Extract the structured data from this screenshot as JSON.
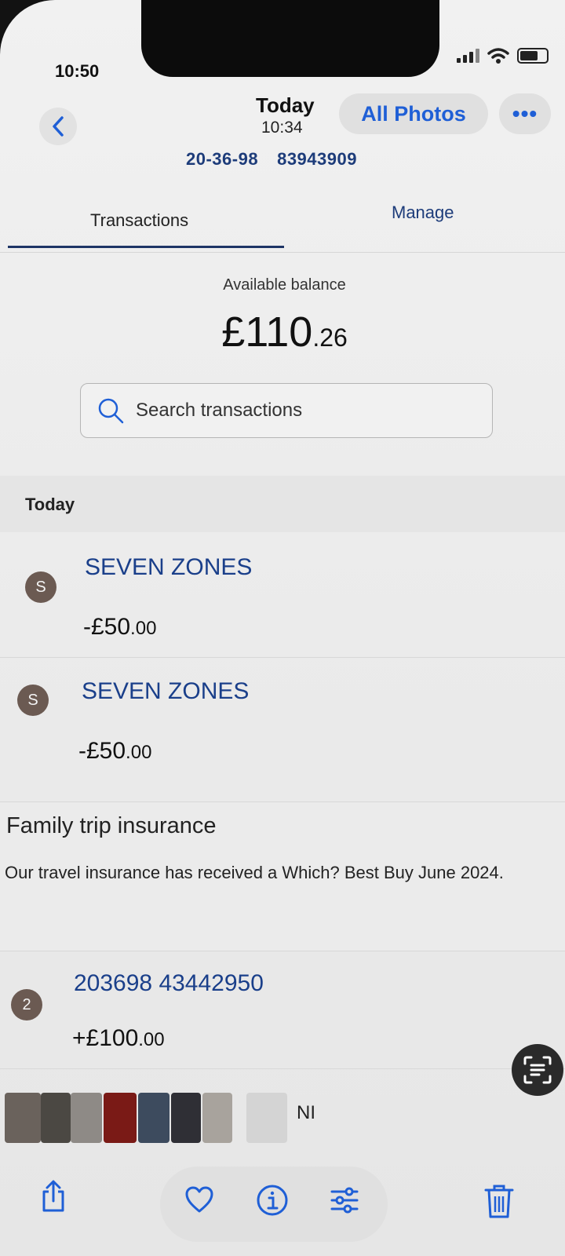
{
  "status": {
    "time": "10:50"
  },
  "header": {
    "back_icon": "chevron-left-icon",
    "title": "Today",
    "subtitle": "10:34",
    "all_photos": "All Photos",
    "more_icon": "ellipsis-icon",
    "more_label": "•••"
  },
  "account": {
    "sort_code": "20-36-98",
    "number": "83943909"
  },
  "tabs": {
    "transactions": "Transactions",
    "manage": "Manage"
  },
  "balance": {
    "label": "Available balance",
    "amount_main": "£110",
    "amount_pence": ".26"
  },
  "search": {
    "placeholder": "Search transactions"
  },
  "section": {
    "label": "Today"
  },
  "transactions": [
    {
      "initial": "S",
      "name": "SEVEN ZONES",
      "amount_main": "-£50",
      "amount_pence": ".00"
    },
    {
      "initial": "S",
      "name": "SEVEN ZONES",
      "amount_main": "-£50",
      "amount_pence": ".00"
    },
    {
      "initial": "2",
      "name": "203698 43442950",
      "amount_main": "+£100",
      "amount_pence": ".00"
    }
  ],
  "promo": {
    "title": "Family trip insurance",
    "body": "Our travel insurance has received a Which? Best Buy June 2024."
  },
  "thumbnails": {
    "caption": "NI"
  },
  "toolbar": {
    "share_icon": "share-icon",
    "favorite_icon": "heart-icon",
    "info_icon": "info-icon",
    "adjust_icon": "adjust-icon",
    "delete_icon": "trash-icon",
    "scan_icon": "live-text-icon"
  },
  "colors": {
    "link": "#1f5fd6",
    "payee": "#1a3f8a",
    "avatar": "#6b5a52"
  }
}
